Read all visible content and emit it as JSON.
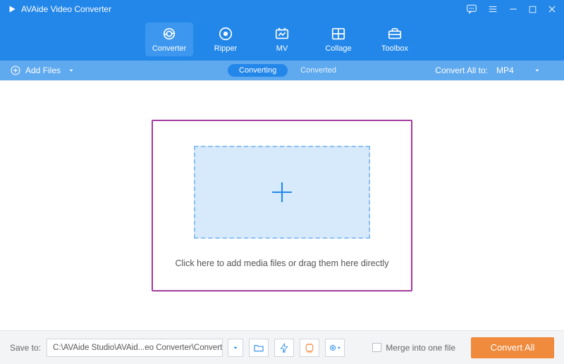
{
  "app": {
    "title": "AVAide Video Converter"
  },
  "tools": {
    "converter": "Converter",
    "ripper": "Ripper",
    "mv": "MV",
    "collage": "Collage",
    "toolbox": "Toolbox"
  },
  "subbar": {
    "add_files": "Add Files",
    "tab_converting": "Converting",
    "tab_converted": "Converted",
    "convert_all_to_label": "Convert All to:",
    "selected_format": "MP4"
  },
  "dropzone": {
    "hint": "Click here to add media files or drag them here directly"
  },
  "footer": {
    "save_to_label": "Save to:",
    "save_path": "C:\\AVAide Studio\\AVAid...eo Converter\\Converted",
    "merge_label": "Merge into one file",
    "convert_all": "Convert All"
  }
}
